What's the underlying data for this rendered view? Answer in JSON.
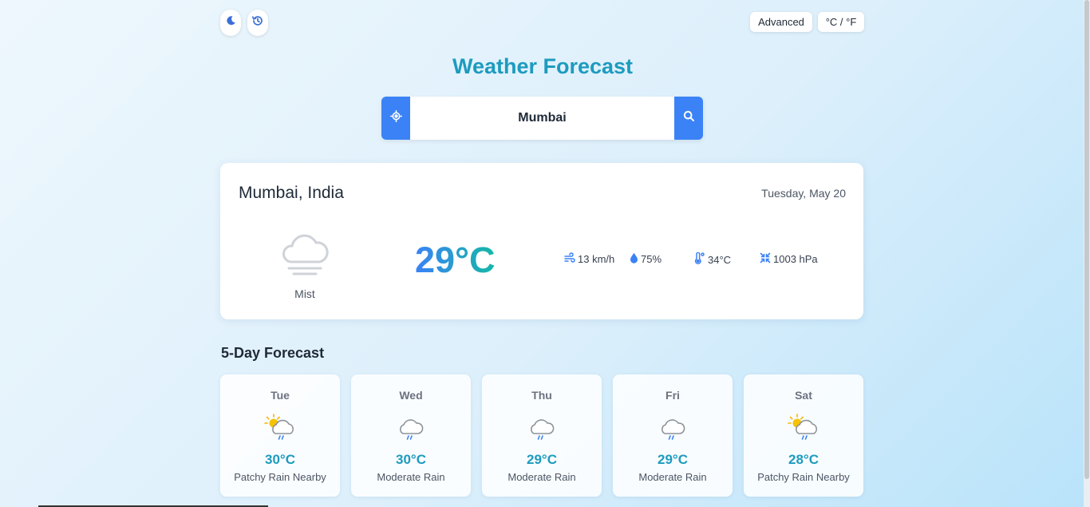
{
  "header": {
    "title": "Weather Forecast",
    "advanced_label": "Advanced",
    "unit_toggle_label": "°C / °F"
  },
  "search": {
    "value": "Mumbai"
  },
  "current": {
    "location": "Mumbai, India",
    "date": "Tuesday, May 20",
    "condition": "Mist",
    "condition_icon": "mist-cloud-icon",
    "temperature": "29°C",
    "wind": "13 km/h",
    "humidity": "75%",
    "feels_like": "34°C",
    "pressure": "1003 hPa"
  },
  "forecast": {
    "heading": "5-Day Forecast",
    "days": [
      {
        "day": "Tue",
        "temp": "30°C",
        "desc": "Patchy Rain Nearby",
        "icon": "sun-cloud-rain-icon"
      },
      {
        "day": "Wed",
        "temp": "30°C",
        "desc": "Moderate Rain",
        "icon": "cloud-rain-icon"
      },
      {
        "day": "Thu",
        "temp": "29°C",
        "desc": "Moderate Rain",
        "icon": "cloud-rain-icon"
      },
      {
        "day": "Fri",
        "temp": "29°C",
        "desc": "Moderate Rain",
        "icon": "cloud-rain-icon"
      },
      {
        "day": "Sat",
        "temp": "28°C",
        "desc": "Patchy Rain Nearby",
        "icon": "sun-cloud-rain-icon"
      }
    ]
  },
  "colors": {
    "accent": "#3b82f6",
    "title": "#1d9bbf",
    "temp_gradient_end": "#14b8a6"
  }
}
